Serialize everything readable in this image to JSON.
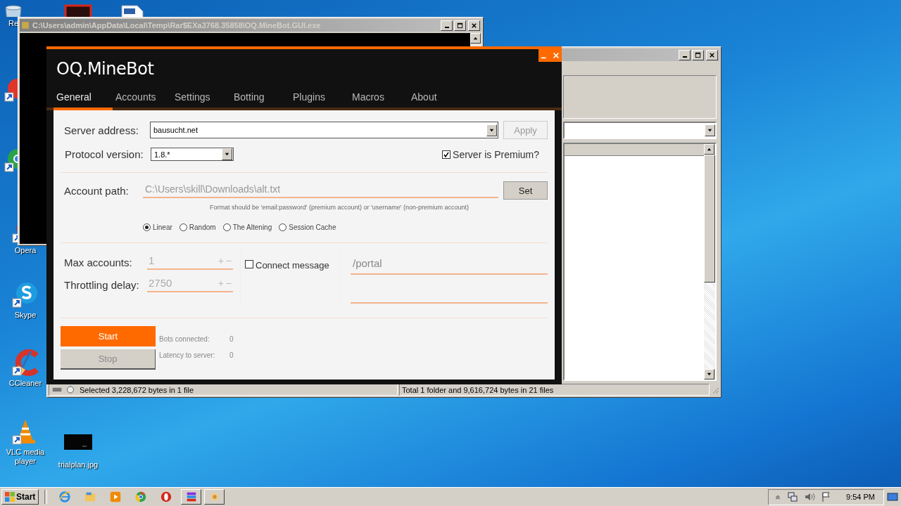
{
  "desktop_icons": [
    {
      "kind": "recycle-bin",
      "label": "Re"
    },
    {
      "kind": "video-file"
    },
    {
      "kind": "document"
    },
    {
      "kind": "program"
    },
    {
      "kind": "chrome"
    },
    {
      "kind": "opera",
      "label": "Opera"
    },
    {
      "kind": "skype",
      "label": "Skype"
    },
    {
      "kind": "ccleaner",
      "label": "CCleaner"
    },
    {
      "kind": "vlc",
      "label": "VLC media player"
    },
    {
      "kind": "image-file",
      "label": "trialplan.jpg"
    }
  ],
  "console_window": {
    "title": "C:\\Users\\admin\\AppData\\Local\\Temp\\Rar$EXa3768.35858\\OQ.MineBot.GUI.exe"
  },
  "explorer_window": {
    "status_bar": [
      "Selected 3,228,672 bytes in 1 file",
      "Total 1 folder and 9,616,724 bytes in 21 files"
    ]
  },
  "app": {
    "title": "OQ.MineBot",
    "tabs": [
      {
        "label": "General",
        "selected": true
      },
      {
        "label": "Accounts",
        "selected": false
      },
      {
        "label": "Settings",
        "selected": false
      },
      {
        "label": "Botting",
        "selected": false
      },
      {
        "label": "Plugins",
        "selected": false
      },
      {
        "label": "Macros",
        "selected": false
      },
      {
        "label": "About",
        "selected": false
      }
    ],
    "server_address": {
      "label": "Server address:",
      "value": "bausucht.net"
    },
    "apply_button": {
      "label": "Apply",
      "disabled": true
    },
    "protocol_version": {
      "label": "Protocol version:",
      "value": "1.8.*"
    },
    "premium": {
      "label": "Server is Premium?",
      "checked": true
    },
    "account_path": {
      "label": "Account path:",
      "value": "C:\\Users\\skill\\Downloads\\alt.txt"
    },
    "set_button": {
      "label": "Set"
    },
    "format_hint": "Format should be 'email:password' (premium account) or 'username' (non-premium account)",
    "account_modes": [
      {
        "label": "Linear",
        "selected": true
      },
      {
        "label": "Random",
        "selected": false
      },
      {
        "label": "The Altening",
        "selected": false
      },
      {
        "label": "Session Cache",
        "selected": false
      }
    ],
    "spinners": [
      {
        "label": "Max accounts:",
        "value": "1",
        "increment": "+",
        "decrement": "−"
      },
      {
        "label": "Throttling delay:",
        "value": "2750",
        "increment": "+",
        "decrement": "−"
      }
    ],
    "connect_message": {
      "label": "Connect message",
      "checked": false,
      "value": "/portal"
    },
    "start_button": {
      "label": "Start",
      "disabled": false
    },
    "stop_button": {
      "label": "Stop",
      "disabled": true
    },
    "stats": [
      {
        "label": "Bots connected:",
        "value": "0"
      },
      {
        "label": "Latency to server:",
        "value": "0"
      }
    ]
  },
  "taskbar": {
    "start": "Start",
    "pinned": [
      {
        "kind": "ie"
      },
      {
        "kind": "explorer"
      },
      {
        "kind": "media-player"
      },
      {
        "kind": "chrome"
      },
      {
        "kind": "opera"
      }
    ],
    "tasks": [
      {
        "kind": "winrar"
      },
      {
        "kind": "app"
      }
    ],
    "clock": "9:54 PM"
  }
}
